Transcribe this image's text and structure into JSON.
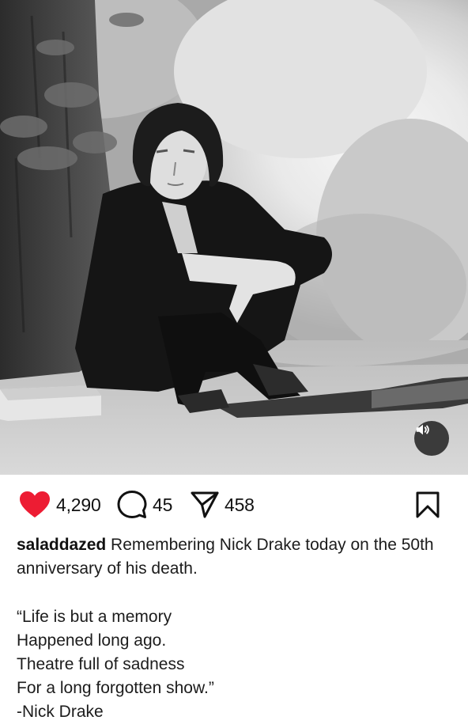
{
  "media": {
    "alt": "Black and white photograph",
    "mute_icon": "speaker-muted-icon"
  },
  "actions": {
    "like": {
      "icon": "heart-filled-icon",
      "color": "#ed1c33",
      "count": "4,290"
    },
    "comment": {
      "icon": "comment-bubble-icon",
      "count": "45"
    },
    "share": {
      "icon": "paper-plane-icon",
      "count": "458"
    },
    "save": {
      "icon": "bookmark-icon"
    }
  },
  "caption": {
    "username": "saladdazed",
    "text": " Remembering Nick Drake today on the 50th anniversary of his death."
  },
  "quote": {
    "lines": [
      "“Life is but a memory",
      "Happened long ago.",
      "Theatre full of sadness",
      "For a long forgotten show.”",
      "-Nick Drake"
    ]
  }
}
